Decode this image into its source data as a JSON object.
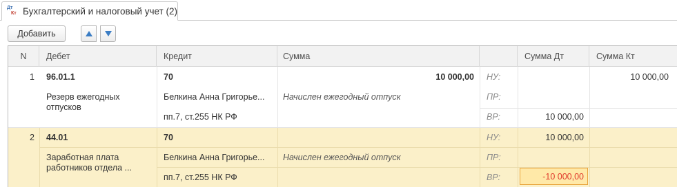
{
  "tab": {
    "icon_top": "Дт",
    "icon_bottom": "Кт",
    "label": "Бухгалтерский и налоговый учет (2)"
  },
  "toolbar": {
    "add_label": "Добавить",
    "move_up_icon": "arrow-up-icon",
    "move_down_icon": "arrow-down-icon"
  },
  "columns": [
    "N",
    "Дебет",
    "Кредит",
    "Сумма",
    "",
    "Сумма Дт",
    "Сумма Кт"
  ],
  "rows": [
    {
      "n": "1",
      "debit": "96.01.1",
      "credit": "70",
      "sum": "10 000,00",
      "nu_label": "НУ:",
      "nu_sum_dt": "",
      "nu_sum_kt": "10 000,00",
      "debit_sub": "Резерв ежегодных отпусков",
      "credit_sub": "Белкина Анна  Григорье...",
      "content": "Начислен ежегодный отпуск",
      "pr_label": "ПР:",
      "credit_sub2": "пп.7, ст.255 НК РФ",
      "vr_label": "ВР:",
      "vr_sum_dt": "10 000,00",
      "selected": false
    },
    {
      "n": "2",
      "debit": "44.01",
      "credit": "70",
      "sum": "",
      "nu_label": "НУ:",
      "nu_sum_dt": "10 000,00",
      "nu_sum_kt": "",
      "debit_sub": "Заработная плата работников отдела ...",
      "credit_sub": "Белкина Анна  Григорье...",
      "content": "Начислен ежегодный отпуск",
      "pr_label": "ПР:",
      "credit_sub2": "пп.7, ст.255 НК РФ",
      "vr_label": "ВР:",
      "vr_sum_dt": "-10 000,00",
      "selected": true
    }
  ],
  "colors": {
    "selected_row": "#fbf0c9",
    "negative_text": "#e03a2c",
    "negative_cell_bg": "#ffe9a8",
    "negative_cell_border": "#e8a33a",
    "accent_blue": "#3b7dc4"
  }
}
